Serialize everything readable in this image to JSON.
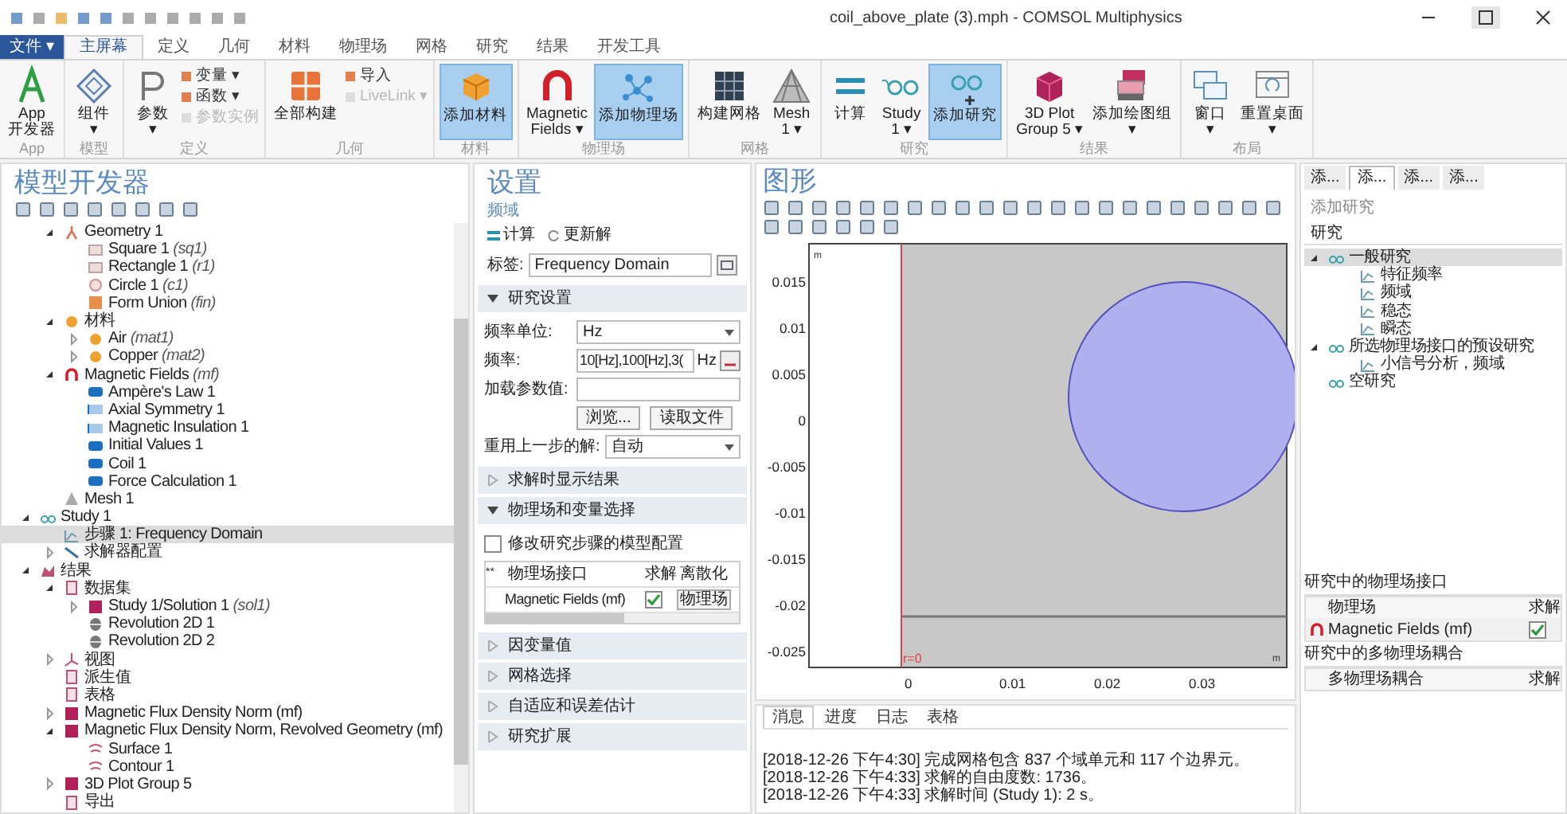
{
  "title_bar": {
    "title": "coil_above_plate (3).mph - COMSOL Multiphysics"
  },
  "file_menu": "文件 ▾",
  "tabs": [
    {
      "label": "主屏幕",
      "selected": true
    },
    {
      "label": "定义",
      "selected": false
    },
    {
      "label": "几何",
      "selected": false
    },
    {
      "label": "材料",
      "selected": false
    },
    {
      "label": "物理场",
      "selected": false
    },
    {
      "label": "网格",
      "selected": false
    },
    {
      "label": "研究",
      "selected": false
    },
    {
      "label": "结果",
      "selected": false
    },
    {
      "label": "开发工具",
      "selected": false
    }
  ],
  "ribbon": [
    {
      "label": "App",
      "buttons": [
        {
          "kind": "app",
          "label": "App\n开发器",
          "selected": false
        }
      ]
    },
    {
      "label": "模型",
      "buttons": [
        {
          "kind": "component",
          "label": "组件\n▾",
          "selected": false
        }
      ]
    },
    {
      "label": "定义",
      "buttons": [
        {
          "kind": "param",
          "label": "参数\n▾",
          "selected": false
        },
        {
          "kind": "small",
          "label": "变量 ▾",
          "disabled": false
        },
        {
          "kind": "small",
          "label": "函数 ▾",
          "disabled": false
        },
        {
          "kind": "small",
          "label": "参数实例",
          "disabled": true
        }
      ]
    },
    {
      "label": "几何",
      "buttons": [
        {
          "kind": "build",
          "label": "全部构建",
          "selected": false
        },
        {
          "kind": "small",
          "label": "导入",
          "disabled": false
        },
        {
          "kind": "small",
          "label": "LiveLink ▾",
          "disabled": true
        }
      ]
    },
    {
      "label": "材料",
      "buttons": [
        {
          "kind": "material",
          "label": "添加材料",
          "selected": true
        }
      ]
    },
    {
      "label": "物理场",
      "buttons": [
        {
          "kind": "magnet",
          "label": "Magnetic\nFields ▾",
          "selected": false
        },
        {
          "kind": "physics",
          "label": "添加物理场",
          "selected": true
        }
      ]
    },
    {
      "label": "网格",
      "buttons": [
        {
          "kind": "meshbuild",
          "label": "构建网格",
          "selected": false
        },
        {
          "kind": "mesh",
          "label": "Mesh\n1 ▾",
          "selected": false
        }
      ]
    },
    {
      "label": "研究",
      "buttons": [
        {
          "kind": "compute",
          "label": "计算",
          "selected": false
        },
        {
          "kind": "study",
          "label": "Study\n1 ▾",
          "selected": false
        },
        {
          "kind": "addstudy",
          "label": "添加研究",
          "selected": true
        }
      ]
    },
    {
      "label": "结果",
      "buttons": [
        {
          "kind": "plot",
          "label": "3D Plot\nGroup 5 ▾",
          "selected": false
        },
        {
          "kind": "addplot",
          "label": "添加绘图组\n▾",
          "selected": false
        }
      ]
    },
    {
      "label": "布局",
      "buttons": [
        {
          "kind": "window",
          "label": "窗口\n▾",
          "selected": false
        },
        {
          "kind": "reset",
          "label": "重置桌面\n▾",
          "selected": false
        }
      ]
    }
  ],
  "model_builder": {
    "title": "模型开发器",
    "tree": [
      {
        "children": [
          {
            "label": "Geometry 1",
            "kind": "geometry",
            "expanded": true,
            "selected": false,
            "children": [
              {
                "label": "Square 1",
                "tag": "(sq1)",
                "kind": "shape",
                "selected": false
              },
              {
                "label": "Rectangle 1",
                "tag": "(r1)",
                "kind": "shape",
                "selected": false
              },
              {
                "label": "Circle 1",
                "tag": "(c1)",
                "kind": "circle",
                "selected": false
              },
              {
                "label": "Form Union",
                "tag": "(fin)",
                "kind": "union",
                "selected": false
              }
            ]
          },
          {
            "label": "材料",
            "kind": "material",
            "expanded": true,
            "selected": false,
            "children": [
              {
                "label": "Air",
                "tag": "(mat1)",
                "kind": "material",
                "expanded": false,
                "selected": false
              },
              {
                "label": "Copper",
                "tag": "(mat2)",
                "kind": "material",
                "expanded": false,
                "selected": false
              }
            ]
          },
          {
            "label": "Magnetic Fields",
            "tag": "(mf)",
            "kind": "magnet",
            "expanded": true,
            "selected": false,
            "children": [
              {
                "label": "Ampère's Law 1",
                "kind": "domain",
                "selected": false
              },
              {
                "label": "Axial Symmetry 1",
                "kind": "boundary",
                "selected": false
              },
              {
                "label": "Magnetic Insulation 1",
                "kind": "boundary",
                "selected": false
              },
              {
                "label": "Initial Values 1",
                "kind": "domain",
                "selected": false
              },
              {
                "label": "Coil 1",
                "kind": "domain",
                "selected": false
              },
              {
                "label": "Force Calculation 1",
                "kind": "domain",
                "selected": false
              }
            ]
          },
          {
            "label": "Mesh 1",
            "kind": "mesh",
            "selected": false
          }
        ]
      },
      {
        "label": "Study 1",
        "kind": "study",
        "expanded": true,
        "selected": false,
        "children": [
          {
            "label": "步骤 1: Frequency Domain",
            "kind": "step",
            "selected": true
          },
          {
            "label": "求解器配置",
            "kind": "solver",
            "expanded": false,
            "selected": false
          }
        ]
      },
      {
        "label": "结果",
        "kind": "results",
        "expanded": true,
        "selected": false,
        "children": [
          {
            "label": "数据集",
            "kind": "data",
            "expanded": true,
            "selected": false,
            "children": [
              {
                "label": "Study 1/Solution 1",
                "tag": "(sol1)",
                "kind": "plot",
                "expanded": false,
                "selected": false
              },
              {
                "label": "Revolution 2D 1",
                "kind": "revolution",
                "selected": false
              },
              {
                "label": "Revolution 2D 2",
                "kind": "revolution",
                "selected": false
              }
            ]
          },
          {
            "label": "视图",
            "kind": "view",
            "expanded": false,
            "selected": false
          },
          {
            "label": "派生值",
            "kind": "data",
            "selected": false
          },
          {
            "label": "表格",
            "kind": "data",
            "selected": false
          },
          {
            "label": "Magnetic Flux Density Norm (mf)",
            "kind": "plot",
            "expanded": false,
            "selected": false
          },
          {
            "label": "Magnetic Flux Density Norm, Revolved Geometry (mf)",
            "kind": "plot",
            "expanded": true,
            "selected": false,
            "children": [
              {
                "label": "Surface 1",
                "kind": "surface",
                "selected": false
              },
              {
                "label": "Contour 1",
                "kind": "surface",
                "selected": false
              }
            ]
          },
          {
            "label": "3D Plot Group 5",
            "kind": "plot",
            "expanded": false,
            "selected": false
          },
          {
            "label": "导出",
            "kind": "data",
            "selected": false
          }
        ]
      }
    ]
  },
  "settings": {
    "title": "设置",
    "subtitle": "频域",
    "toolbar": [
      {
        "kind": "compute",
        "label": "计算"
      },
      {
        "kind": "update",
        "label": "更新解"
      }
    ],
    "label_field": {
      "label": "标签:",
      "value": "Frequency Domain"
    },
    "sections": [
      {
        "title": "研究设置",
        "expanded": true,
        "rows": [
          {
            "kind": "select",
            "label": "频率单位:",
            "value": "Hz"
          },
          {
            "kind": "input",
            "label": "频率:",
            "value": "10[Hz],100[Hz],3(",
            "unit": "Hz"
          },
          {
            "kind": "input",
            "label": "加载参数值:"
          },
          {
            "kind": "buttons",
            "buttons": [
              "浏览...",
              "读取文件"
            ]
          },
          {
            "kind": "select",
            "label": "重用上一步的解:",
            "value": "自动"
          }
        ]
      },
      {
        "title": "求解时显示结果",
        "expanded": false
      },
      {
        "title": "物理场和变量选择",
        "expanded": true,
        "rows": [
          {
            "kind": "checkbox",
            "label": "修改研究步骤的模型配置",
            "checked": false
          },
          {
            "kind": "table",
            "columns": [
              "**",
              "物理场接口",
              "求解",
              "离散化"
            ],
            "rows": [
              {
                "name": "Magnetic Fields (mf)",
                "checked": true,
                "button": "物理场"
              }
            ]
          }
        ]
      },
      {
        "title": "因变量值",
        "expanded": false
      },
      {
        "title": "网格选择",
        "expanded": false
      },
      {
        "title": "自适应和误差估计",
        "expanded": false
      },
      {
        "title": "研究扩展",
        "expanded": false
      }
    ]
  },
  "graphics": {
    "title": "图形",
    "plot": {
      "unit_top": "m",
      "unit_corner": "m",
      "axis_label": "r=0",
      "yticks": [
        "0.015",
        "0.01",
        "0.005",
        "0",
        "-0.005",
        "-0.01",
        "-0.015",
        "-0.02",
        "-0.025"
      ],
      "xticks": [
        "0",
        "0.01",
        "0.02",
        "0.03"
      ]
    }
  },
  "messages": {
    "tabs": [
      {
        "label": "消息",
        "selected": true
      },
      {
        "label": "进度",
        "selected": false
      },
      {
        "label": "日志",
        "selected": false
      },
      {
        "label": "表格",
        "selected": false
      }
    ],
    "lines": [
      "[2018-12-26 下午4:30] 完成网格包含 837 个域单元和 117 个边界元。",
      "[2018-12-26 下午4:33] 求解的自由度数: 1736。",
      "[2018-12-26 下午4:33] 求解时间 (Study 1): 2 s。"
    ]
  },
  "add_study": {
    "tabs": [
      {
        "label": "添...",
        "selected": false
      },
      {
        "label": "添...",
        "selected": true
      },
      {
        "label": "添...",
        "selected": false
      },
      {
        "label": "添...",
        "selected": false
      }
    ],
    "add_button": "添加研究",
    "header": "研究",
    "tree": [
      {
        "label": "一般研究",
        "kind": "study",
        "expanded": true,
        "selected": true,
        "children": [
          {
            "label": "特征频率",
            "kind": "step",
            "selected": false
          },
          {
            "label": "频域",
            "kind": "step",
            "selected": false
          },
          {
            "label": "稳态",
            "kind": "step",
            "selected": false
          },
          {
            "label": "瞬态",
            "kind": "step",
            "selected": false
          }
        ]
      },
      {
        "label": "所选物理场接口的预设研究",
        "kind": "study",
        "expanded": true,
        "selected": false,
        "children": [
          {
            "label": "小信号分析，频域",
            "kind": "step",
            "selected": false
          }
        ]
      },
      {
        "label": "空研究",
        "kind": "study",
        "selected": false
      }
    ],
    "physics_section": {
      "title": "研究中的物理场接口",
      "columns": [
        "物理场",
        "求解"
      ],
      "rows": [
        {
          "name": "Magnetic Fields (mf)",
          "checked": true
        }
      ]
    },
    "multiphysics_section": {
      "title": "研究中的多物理场耦合",
      "columns": [
        "多物理场耦合",
        "求解"
      ]
    }
  }
}
